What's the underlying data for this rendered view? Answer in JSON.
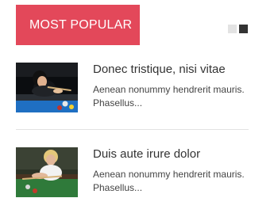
{
  "widget": {
    "heading": "MOST POPULAR",
    "colors": {
      "accent": "#e3485a",
      "pager_active": "#333333",
      "pager_inactive": "#e3e3e3"
    },
    "pager": {
      "pages": 2,
      "active_index": 1
    }
  },
  "articles": [
    {
      "title": "Donec tristique, nisi vitae",
      "excerpt": "Aenean nonummy hendrerit mauris. Phasellus...",
      "thumbnail": "woman-playing-billiards"
    },
    {
      "title": "Duis aute irure dolor",
      "excerpt": "Aenean nonummy hendrerit mauris. Phasellus...",
      "thumbnail": "man-playing-billiards"
    }
  ]
}
